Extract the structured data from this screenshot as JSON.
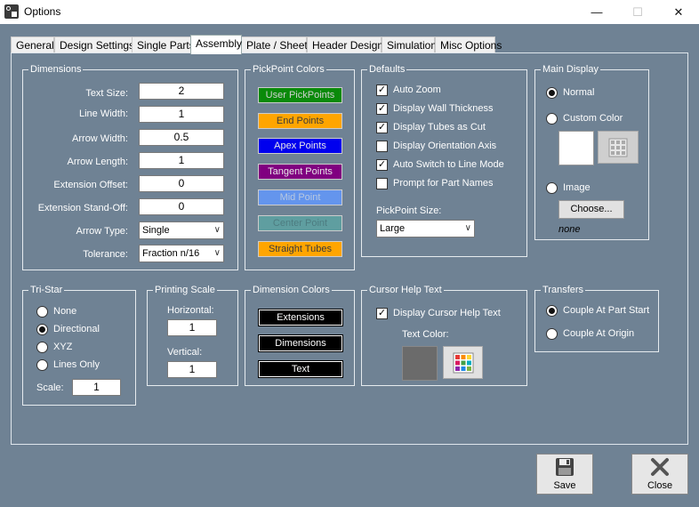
{
  "window": {
    "title": "Options"
  },
  "tabs": [
    {
      "label": "General"
    },
    {
      "label": "Design Settings"
    },
    {
      "label": "Single Parts"
    },
    {
      "label": "Assembly"
    },
    {
      "label": "Plate / Sheet"
    },
    {
      "label": "Header Design"
    },
    {
      "label": "Simulation"
    },
    {
      "label": "Misc Options"
    }
  ],
  "dimensions": {
    "title": "Dimensions",
    "text_size": {
      "label": "Text Size:",
      "value": "2"
    },
    "line_width": {
      "label": "Line Width:",
      "value": "1"
    },
    "arrow_width": {
      "label": "Arrow Width:",
      "value": "0.5"
    },
    "arrow_length": {
      "label": "Arrow Length:",
      "value": "1"
    },
    "extension_offset": {
      "label": "Extension Offset:",
      "value": "0"
    },
    "extension_standoff": {
      "label": "Extension Stand-Off:",
      "value": "0"
    },
    "arrow_type": {
      "label": "Arrow Type:",
      "value": "Single"
    },
    "tolerance": {
      "label": "Tolerance:",
      "value": "Fraction n/16"
    }
  },
  "pickpoint_colors": {
    "title": "PickPoint Colors",
    "buttons": [
      {
        "label": "User PickPoints",
        "bg": "#0a8a0a",
        "fg": "#d0d0d0"
      },
      {
        "label": "End Points",
        "bg": "#ffa500",
        "fg": "#3a3a3a"
      },
      {
        "label": "Apex Points",
        "bg": "#0000ee",
        "fg": "#e8e8e8"
      },
      {
        "label": "Tangent Points",
        "bg": "#800080",
        "fg": "#e8e8e8"
      },
      {
        "label": "Mid Point",
        "bg": "#6495ed",
        "fg": "#b8c8e0"
      },
      {
        "label": "Center Point",
        "bg": "#5f9ea0",
        "fg": "#4d7c80"
      },
      {
        "label": "Straight Tubes",
        "bg": "#ffa500",
        "fg": "#3a3a3a"
      }
    ]
  },
  "defaults": {
    "title": "Defaults",
    "options": [
      {
        "label": "Auto Zoom",
        "checked": true
      },
      {
        "label": "Display Wall Thickness",
        "checked": true
      },
      {
        "label": "Display Tubes as Cut",
        "checked": true
      },
      {
        "label": "Display Orientation Axis",
        "checked": false
      },
      {
        "label": "Auto Switch to Line Mode",
        "checked": true
      },
      {
        "label": "Prompt for Part Names",
        "checked": false
      }
    ],
    "pickpoint_size_label": "PickPoint Size:",
    "pickpoint_size_value": "Large"
  },
  "main_display": {
    "title": "Main Display",
    "normal_label": "Normal",
    "custom_color_label": "Custom Color",
    "image_label": "Image",
    "choose_label": "Choose...",
    "image_value": "none"
  },
  "tristar": {
    "title": "Tri-Star",
    "options": [
      "None",
      "Directional",
      "XYZ",
      "Lines Only"
    ],
    "selected": "Directional",
    "scale_label": "Scale:",
    "scale_value": "1"
  },
  "printing_scale": {
    "title": "Printing Scale",
    "horizontal_label": "Horizontal:",
    "horizontal_value": "1",
    "vertical_label": "Vertical:",
    "vertical_value": "1"
  },
  "dimension_colors": {
    "title": "Dimension Colors",
    "buttons": [
      "Extensions",
      "Dimensions",
      "Text"
    ]
  },
  "cursor_help": {
    "title": "Cursor Help Text",
    "display_label": "Display Cursor Help Text",
    "text_color_label": "Text Color:",
    "swatch_color": "#6b6b6b"
  },
  "transfers": {
    "title": "Transfers",
    "options": [
      "Couple At Part Start",
      "Couple At Origin"
    ],
    "selected": "Couple At Part Start"
  },
  "footer": {
    "save_label": "Save",
    "close_label": "Close"
  },
  "colors": {
    "panel_bg": "#6f8294"
  }
}
